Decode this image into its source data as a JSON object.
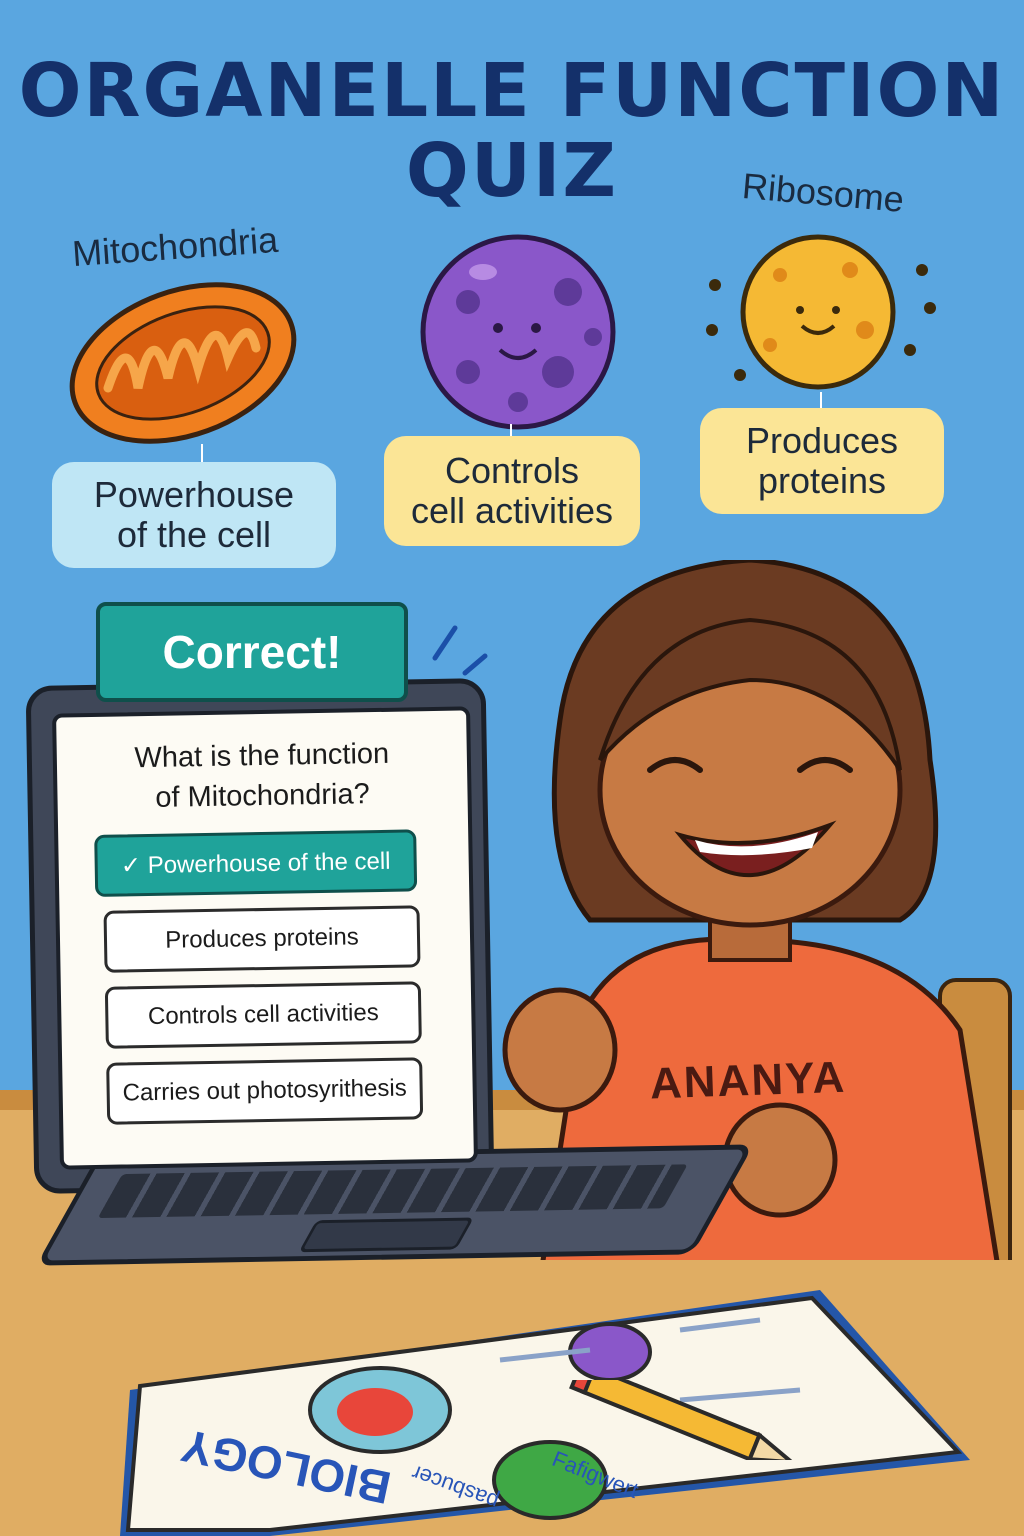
{
  "title": {
    "line1": "ORGANELLE FUNCTION",
    "line2": "QUIZ"
  },
  "organelles": [
    {
      "name": "Mitochondria",
      "function_line1": "Powerhouse",
      "function_line2": "of the cell",
      "color": "#f07f1f"
    },
    {
      "name": "",
      "function_line1": "Controls",
      "function_line2": "cell activities",
      "color": "#8a57c9"
    },
    {
      "name": "Ribosome",
      "function_line1": "Produces",
      "function_line2": "proteins",
      "color": "#f5b934"
    }
  ],
  "feedback": {
    "label": "Correct!",
    "color": "#1fa39a"
  },
  "quiz": {
    "question_line1": "What is the function",
    "question_line2": "of Mitochondria?",
    "options": [
      {
        "label": "✓ Powerhouse of the cell",
        "selected": true
      },
      {
        "label": "Produces proteins",
        "selected": false
      },
      {
        "label": "Controls cell activities",
        "selected": false
      },
      {
        "label": "Carries out photosyrithesis",
        "selected": false
      }
    ]
  },
  "student": {
    "shirt_name": "ANANYA",
    "shirt_color": "#ee6a3d"
  },
  "notebook": {
    "cover_word": "BIOLOGY",
    "scribble_1": "Fafigwert",
    "scribble_2": "pasbucer"
  },
  "icons": [
    "mitochondria-icon",
    "nucleus-icon",
    "ribosome-icon",
    "check-icon",
    "pencil-icon"
  ]
}
